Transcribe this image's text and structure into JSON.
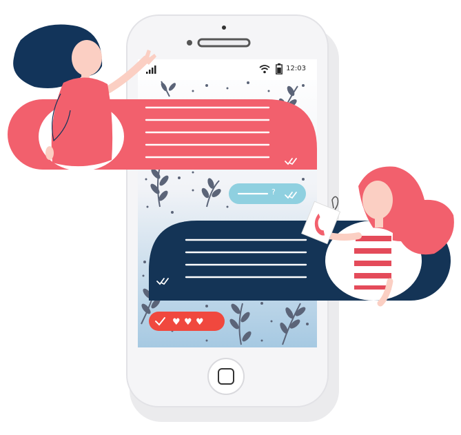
{
  "status_bar": {
    "time": "12:03",
    "signal_icon": "signal-bars-icon",
    "wifi_icon": "wifi-icon",
    "battery_icon": "battery-icon"
  },
  "reply_bubble": {
    "text": "?"
  },
  "reaction_bubble": {
    "hearts": [
      "♥",
      "♥",
      "♥"
    ]
  },
  "colors": {
    "coral": "#f2606d",
    "navy": "#143456",
    "light_blue": "#8fd0e0",
    "reaction_red": "#f0483e",
    "phone_body": "#f4f4f6"
  }
}
